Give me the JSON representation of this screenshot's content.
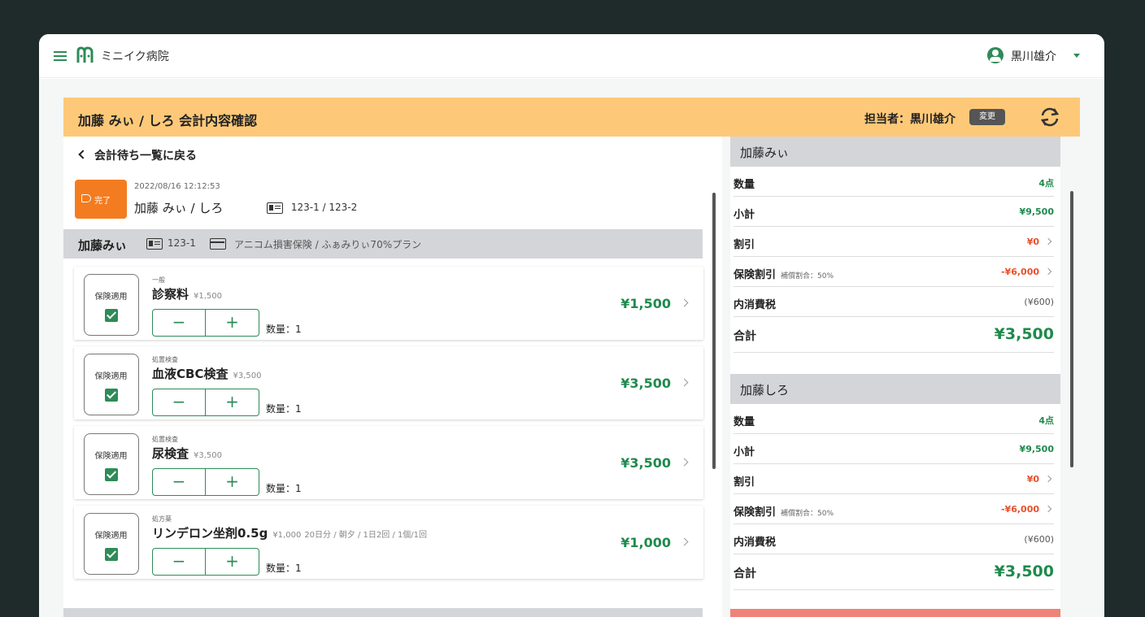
{
  "app": {
    "brand": "ミニイク病院",
    "user": "黒川雄介"
  },
  "header": {
    "title": "加藤 みぃ / しろ 会計内容確認",
    "assignee": "担当者：黒川雄介",
    "change_label": "変更"
  },
  "left": {
    "back_label": "会計待ち一覧に戻る",
    "badge_label": "完了",
    "visit_time": "2022/08/16 12:12:53",
    "visit_owner": "加藤 みぃ / しろ",
    "visit_ids": "123-1 / 123-2",
    "owner1": {
      "name": "加藤みぃ",
      "id": "123-1",
      "plan": "アニコム損害保険 / ふぁみりぃ70%プラン"
    },
    "items": [
      {
        "category": "一般",
        "name": "診察料",
        "price": "¥1,500",
        "note": "",
        "ins_label": "保険適用",
        "qty": "数量：1",
        "total": "¥1,500"
      },
      {
        "category": "処置検査",
        "name": "血液CBC検査",
        "price": "¥3,500",
        "note": "",
        "ins_label": "保険適用",
        "qty": "数量：1",
        "total": "¥3,500"
      },
      {
        "category": "処置検査",
        "name": "尿検査",
        "price": "¥3,500",
        "note": "",
        "ins_label": "保険適用",
        "qty": "数量：1",
        "total": "¥3,500"
      },
      {
        "category": "処方薬",
        "name": "リンデロン坐剤0.5g",
        "price": "¥1,000",
        "note": "20日分 / 朝夕 / 1日2回 / 1個/1回",
        "ins_label": "保険適用",
        "qty": "数量：1",
        "total": "¥1,000"
      }
    ]
  },
  "summary": [
    {
      "name": "加藤みぃ",
      "qty_label": "数量",
      "qty": "4点",
      "subtotal_label": "小計",
      "subtotal": "¥9,500",
      "discount_label": "割引",
      "discount": "¥0",
      "ins_label": "保険割引",
      "ins_sub": "補償割合：50%",
      "ins": "-¥6,000",
      "tax_label": "内消費税",
      "tax": "(¥600)",
      "total_label": "合計",
      "total": "¥3,500"
    },
    {
      "name": "加藤しろ",
      "qty_label": "数量",
      "qty": "4点",
      "subtotal_label": "小計",
      "subtotal": "¥9,500",
      "discount_label": "割引",
      "discount": "¥0",
      "ins_label": "保険割引",
      "ins_sub": "補償割合：50%",
      "ins": "-¥6,000",
      "tax_label": "内消費税",
      "tax": "(¥600)",
      "total_label": "合計",
      "total": "¥3,500"
    }
  ],
  "colors": {
    "accent": "#2e8b57",
    "title_bar": "#fdc979",
    "done_badge": "#f47c20",
    "discount_red": "#e8502a"
  },
  "icons": [
    "menu-icon",
    "logo-icon",
    "user-icon",
    "caret-down-icon",
    "refresh-icon",
    "chevron-left-icon",
    "tag-icon",
    "id-card-icon",
    "credit-card-icon",
    "checkbox-checked-icon",
    "chevron-right-icon"
  ]
}
